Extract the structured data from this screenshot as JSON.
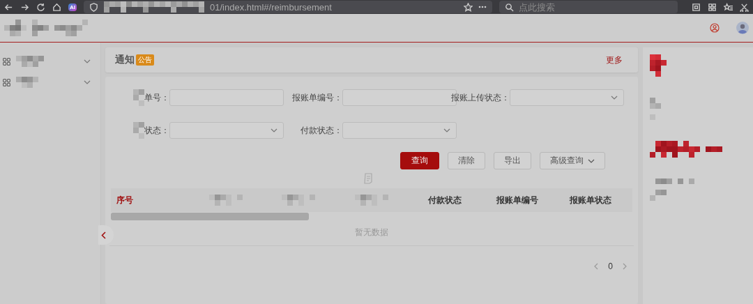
{
  "browser": {
    "ai_badge": "AI",
    "url": "01/index.html#/reimbursement",
    "search_placeholder": "点此搜索"
  },
  "sidebar": {
    "items": [
      {
        "expanded": false
      },
      {
        "expanded": false
      }
    ]
  },
  "notice": {
    "title": "通知",
    "badge": "公告",
    "more": "更多"
  },
  "filters": [
    {
      "label": "单号：",
      "redacted_prefix": true,
      "kind": "input"
    },
    {
      "label": "报账单编号：",
      "redacted_prefix": false,
      "kind": "input"
    },
    {
      "label": "报账上传状态：",
      "redacted_prefix": false,
      "kind": "select"
    },
    {
      "label": "状态：",
      "redacted_prefix": true,
      "kind": "select"
    },
    {
      "label": "付款状态：",
      "redacted_prefix": false,
      "kind": "select"
    }
  ],
  "buttons": [
    {
      "label": "查询",
      "kind": "primary"
    },
    {
      "label": "清除",
      "kind": "plain"
    },
    {
      "label": "导出",
      "kind": "plain"
    },
    {
      "label": "高级查询",
      "kind": "dropdown"
    }
  ],
  "table": {
    "columns": [
      {
        "kind": "text",
        "label": "序号",
        "active": true
      },
      {
        "kind": "redacted"
      },
      {
        "kind": "redacted"
      },
      {
        "kind": "redacted"
      },
      {
        "kind": "text",
        "label": "付款状态",
        "active": false
      },
      {
        "kind": "text",
        "label": "报账单编号",
        "active": false
      },
      {
        "kind": "text",
        "label": "报账单状态",
        "active": false
      }
    ],
    "empty_text": "暂无数据"
  },
  "pagination": {
    "page": "0"
  }
}
